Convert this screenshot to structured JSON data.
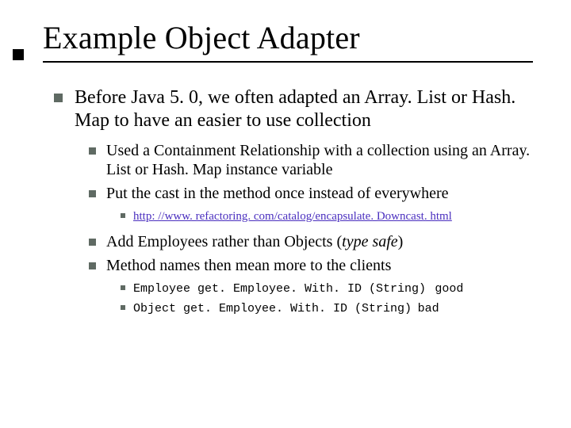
{
  "title": "Example Object Adapter",
  "body": {
    "point": "Before Java 5. 0, we often adapted an Array. List or Hash. Map to have an easier to use collection",
    "subA1": "Used a Containment Relationship with a collection using an Array. List or Hash. Map instance variable",
    "subA2": "Put the cast in the method once instead of everywhere",
    "link": "http: //www. refactoring. com/catalog/encapsulate. Downcast. html",
    "subB1_pre": "Add Employees rather than Objects (",
    "subB1_em": "type safe",
    "subB1_post": ")",
    "subB2": "Method names then mean more to the clients",
    "code_good_sig": "Employee get. Employee. With. ID (String)",
    "code_good_tag": "good",
    "code_bad_sig": "Object get. Employee. With. ID (String)",
    "code_bad_tag": "bad"
  }
}
